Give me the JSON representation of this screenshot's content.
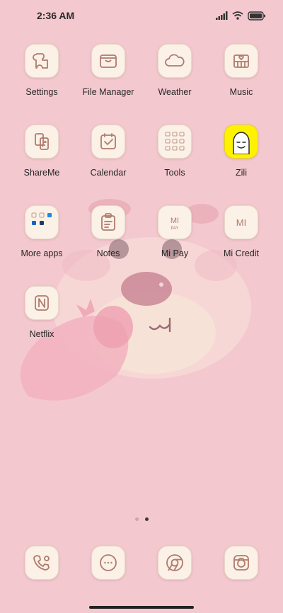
{
  "status": {
    "time": "2:36 AM"
  },
  "apps": [
    {
      "label": "Settings"
    },
    {
      "label": "File Manager"
    },
    {
      "label": "Weather"
    },
    {
      "label": "Music"
    },
    {
      "label": "ShareMe"
    },
    {
      "label": "Calendar"
    },
    {
      "label": "Tools"
    },
    {
      "label": "Zili"
    },
    {
      "label": "More apps"
    },
    {
      "label": "Notes"
    },
    {
      "label": "Mi Pay",
      "glyph": "MI PAY"
    },
    {
      "label": "Mi Credit",
      "glyph": "MI"
    },
    {
      "label": "Netflix",
      "glyph": "N"
    }
  ],
  "dock": [
    {
      "icon": "phone-icon"
    },
    {
      "icon": "messages-icon"
    },
    {
      "icon": "chrome-icon"
    },
    {
      "icon": "camera-icon"
    }
  ],
  "pages": {
    "count": 2,
    "current": 2
  },
  "colors": {
    "background": "#f3c8cf",
    "icon_bg": "#fbf1e6",
    "icon_line": "#b07a6e"
  }
}
